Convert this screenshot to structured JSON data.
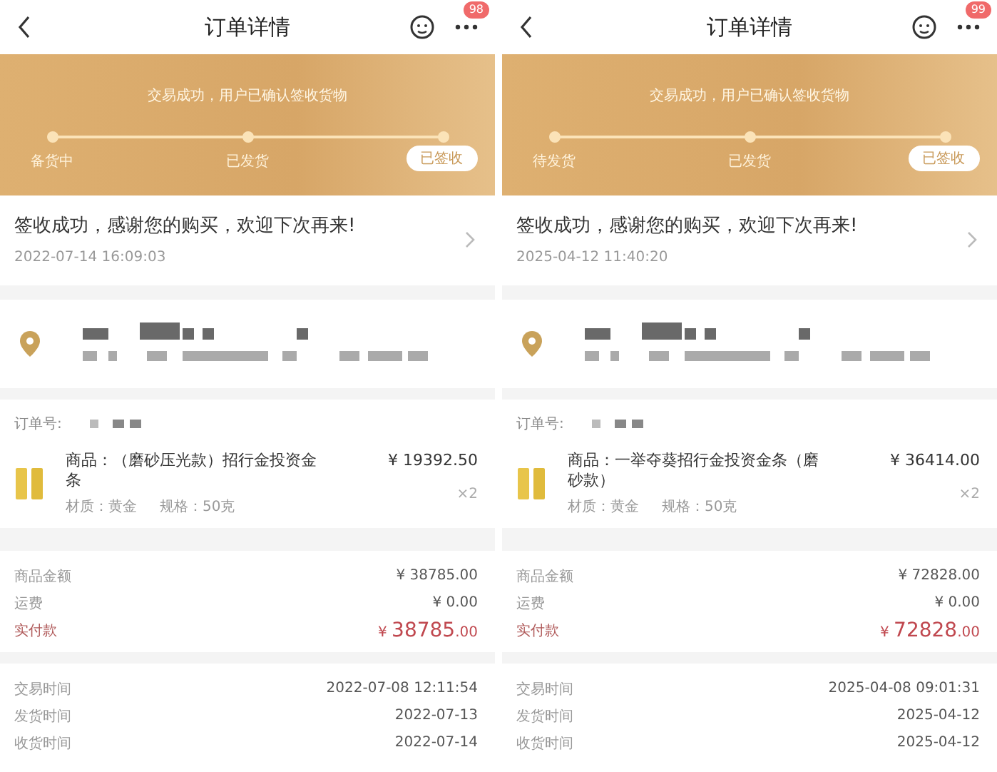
{
  "panels": [
    {
      "nav": {
        "title": "订单详情",
        "badge": "98"
      },
      "banner": {
        "message": "交易成功，用户已确认签收货物",
        "steps": [
          {
            "label": "备货中",
            "selected": false
          },
          {
            "label": "已发货",
            "selected": false
          },
          {
            "label": "已签收",
            "selected": true
          }
        ]
      },
      "notice": {
        "text": "签收成功，感谢您的购买，欢迎下次再来!",
        "time": "2022-07-14 16:09:03"
      },
      "order": {
        "label": "订单号:",
        "product": {
          "name": "商品：（磨砂压光款）招行金投资金条",
          "price": "¥ 19392.50",
          "quantity": "×2",
          "material": "材质：黄金",
          "spec": "规格：50克"
        }
      },
      "amounts": {
        "rows": [
          {
            "label": "商品金额",
            "value": "¥ 38785.00"
          },
          {
            "label": "运费",
            "value": "¥ 0.00"
          }
        ],
        "total": {
          "label": "实付款",
          "currency": "¥",
          "amount": "38785",
          "fraction": ".00"
        }
      },
      "times": [
        {
          "label": "交易时间",
          "value": "2022-07-08 12:11:54"
        },
        {
          "label": "发货时间",
          "value": "2022-07-13"
        },
        {
          "label": "收货时间",
          "value": "2022-07-14"
        }
      ]
    },
    {
      "nav": {
        "title": "订单详情",
        "badge": "99"
      },
      "banner": {
        "message": "交易成功，用户已确认签收货物",
        "steps": [
          {
            "label": "待发货",
            "selected": false
          },
          {
            "label": "已发货",
            "selected": false
          },
          {
            "label": "已签收",
            "selected": true
          }
        ]
      },
      "notice": {
        "text": "签收成功，感谢您的购买，欢迎下次再来!",
        "time": "2025-04-12 11:40:20"
      },
      "order": {
        "label": "订单号:",
        "product": {
          "name": "商品：一举夺葵招行金投资金条（磨砂款）",
          "price": "¥ 36414.00",
          "quantity": "×2",
          "material": "材质：黄金",
          "spec": "规格：50克"
        }
      },
      "amounts": {
        "rows": [
          {
            "label": "商品金额",
            "value": "¥ 72828.00"
          },
          {
            "label": "运费",
            "value": "¥ 0.00"
          }
        ],
        "total": {
          "label": "实付款",
          "currency": "¥",
          "amount": "72828",
          "fraction": ".00"
        }
      },
      "times": [
        {
          "label": "交易时间",
          "value": "2025-04-08 09:01:31"
        },
        {
          "label": "发货时间",
          "value": "2025-04-12"
        },
        {
          "label": "收货时间",
          "value": "2025-04-12"
        }
      ]
    }
  ]
}
